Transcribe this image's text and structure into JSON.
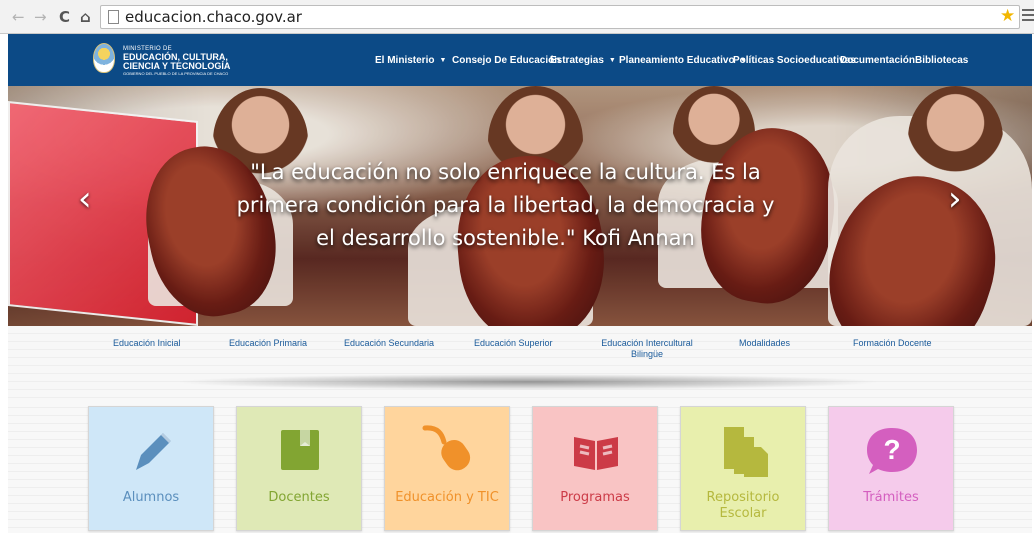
{
  "browser": {
    "back_symbol": "←",
    "forward_symbol": "→",
    "reload_symbol": "C",
    "home_symbol": "⌂",
    "url": "educacion.chaco.gov.ar",
    "star_symbol": "★"
  },
  "site": {
    "logo_line1": "MINISTERIO DE",
    "logo_line2": "EDUCACIÓN, CULTURA,",
    "logo_line3": "CIENCIA Y TECNOLOGÍA",
    "logo_line4": "GOBIERNO DEL PUEBLO DE LA PROVINCIA DE CHACO",
    "nav": [
      {
        "label": "El Ministerio",
        "caret": "▼"
      },
      {
        "label": "Consejo De Educación"
      },
      {
        "label": "Estrategias",
        "caret": "▼"
      },
      {
        "label": "Planeamiento Educativo",
        "caret": "▼"
      },
      {
        "label": "Políticas Socioeducativas"
      },
      {
        "label": "Documentación"
      },
      {
        "label": "Bibliotecas"
      }
    ]
  },
  "hero": {
    "quote": "\"La educación no solo enriquece la cultura. Es la primera condición para la libertad, la democracia y el desarrollo sostenible.\" Kofi Annan",
    "prev_symbol": "‹",
    "next_symbol": "›"
  },
  "levels": [
    "Educación Inicial",
    "Educación Primaria",
    "Educación Secundaria",
    "Educación Superior",
    "Educación Intercultural\nBilingüe",
    "Modalidades",
    "Formación Docente"
  ],
  "cards": [
    {
      "label": "Alumnos",
      "icon": "pencil-icon",
      "bg": "#cfe7f8",
      "fg": "#5b8fbd"
    },
    {
      "label": "Docentes",
      "icon": "book-icon",
      "bg": "#dfe9b6",
      "fg": "#82a532"
    },
    {
      "label": "Educación y TIC",
      "icon": "mouse-icon",
      "bg": "#ffd59d",
      "fg": "#f0912a"
    },
    {
      "label": "Programas",
      "icon": "open-book-icon",
      "bg": "#f9c4c4",
      "fg": "#cc3b47"
    },
    {
      "label": "Repositorio\nEscolar",
      "icon": "documents-icon",
      "bg": "#e8efad",
      "fg": "#b5b83e"
    },
    {
      "label": "Trámites",
      "icon": "help-icon",
      "bg": "#f5cbeb",
      "fg": "#d45fbf"
    }
  ]
}
